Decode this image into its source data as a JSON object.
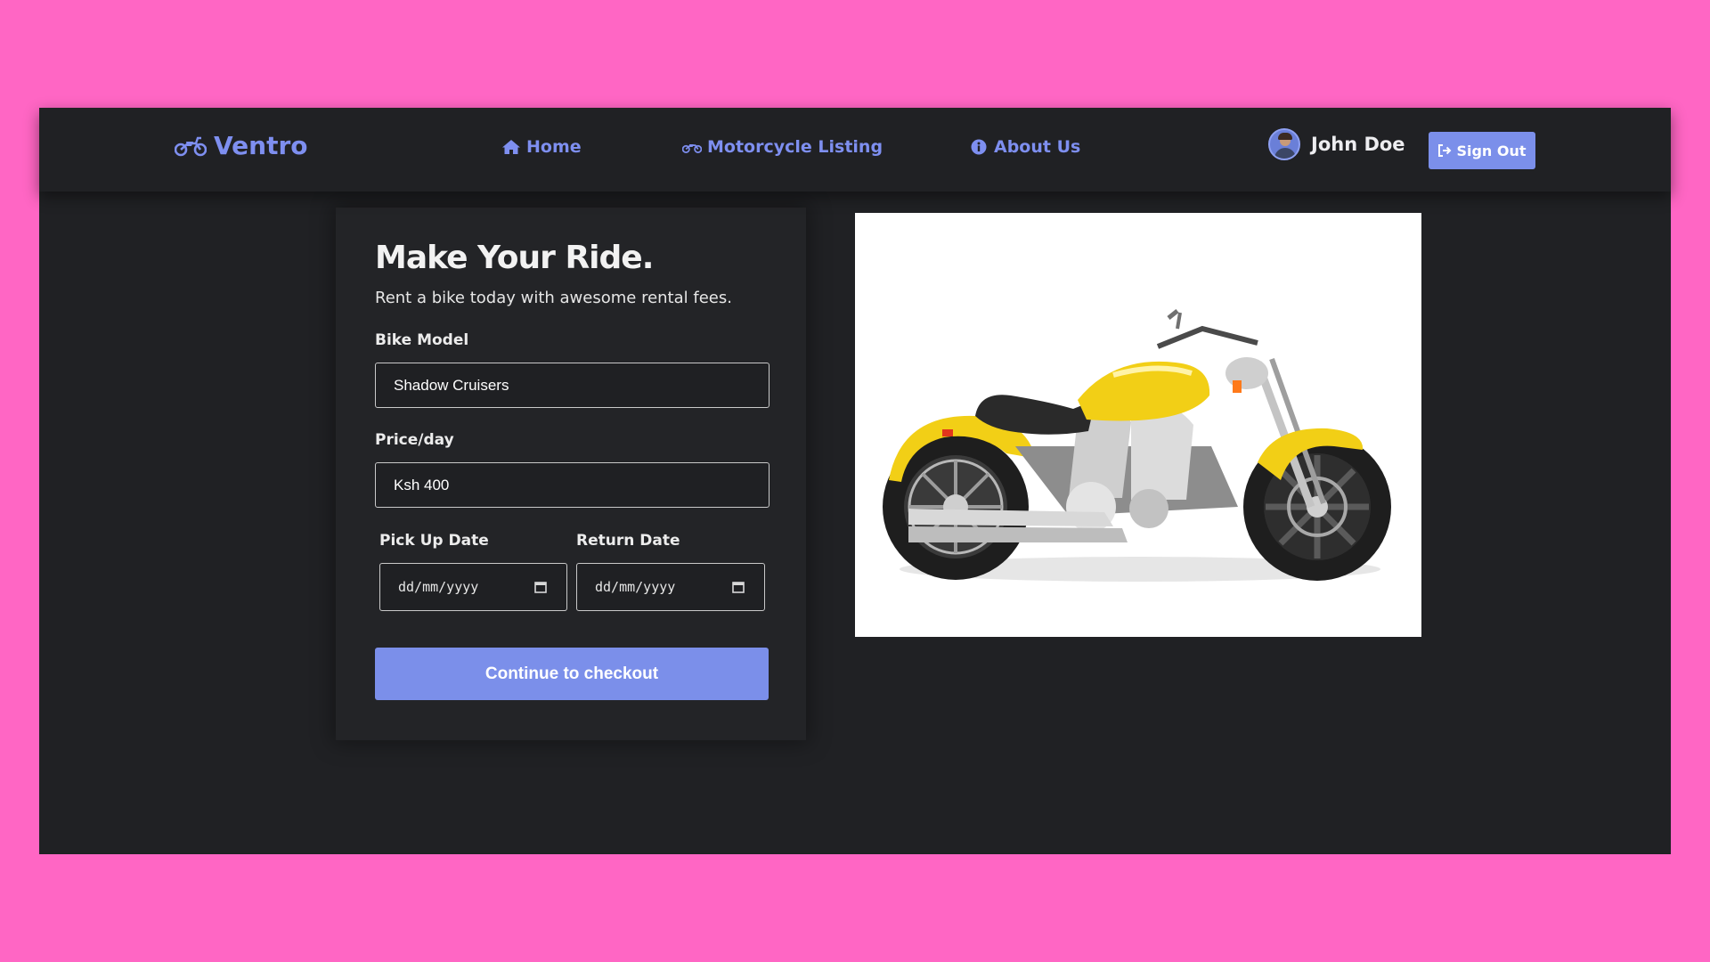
{
  "nav": {
    "brand": "Ventro",
    "brand_icon": "motorcycle-icon",
    "links": [
      {
        "label": "Home",
        "icon": "home-icon"
      },
      {
        "label": "Motorcycle Listing",
        "icon": "motorcycle-icon"
      },
      {
        "label": "About Us",
        "icon": "info-icon"
      }
    ],
    "user_name": "John Doe",
    "sign_out_label": "Sign Out",
    "sign_out_icon": "sign-out-icon"
  },
  "form": {
    "title": "Make Your Ride.",
    "subtitle": "Rent a bike today with awesome rental fees.",
    "bike_model_label": "Bike Model",
    "bike_model_value": "Shadow Cruisers",
    "price_label": "Price/day",
    "price_value": "Ksh 400",
    "pickup_label": "Pick Up Date",
    "pickup_placeholder": "dd/mm/yyyy",
    "return_label": "Return Date",
    "return_placeholder": "dd/mm/yyyy",
    "checkout_label": "Continue to checkout"
  },
  "colors": {
    "page_background": "#ff66c4",
    "app_background": "#202124",
    "accent": "#7b8fea",
    "nav_link": "#7e8ff0",
    "bike_body": "#f2cf16"
  }
}
